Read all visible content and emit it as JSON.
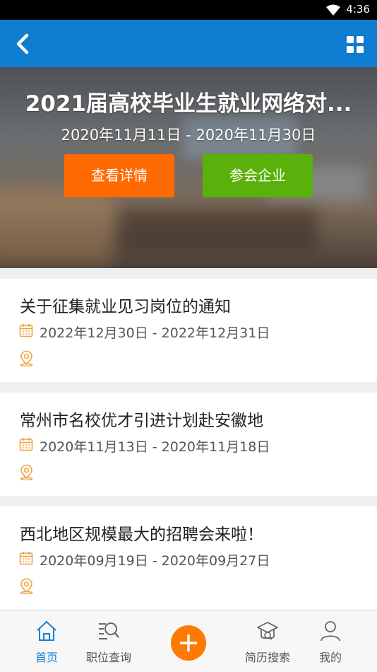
{
  "status_bar": {
    "time": "4:36"
  },
  "banner": {
    "title": "2021届高校毕业生就业网络对...",
    "date_range": "2020年11月11日 - 2020年11月30日",
    "detail_button": "查看详情",
    "company_button": "参会企业"
  },
  "jobs": [
    {
      "title": "关于征集就业见习岗位的通知",
      "date_range": "2022年12月30日 - 2022年12月31日"
    },
    {
      "title": "常州市名校优才引进计划赴安徽地",
      "date_range": "2020年11月13日 - 2020年11月18日"
    },
    {
      "title": "西北地区规模最大的招聘会来啦！",
      "date_range": "2020年09月19日 - 2020年09月27日"
    }
  ],
  "bottom_nav": {
    "home": "首页",
    "job_search": "职位查询",
    "resume_search": "简历搜索",
    "mine": "我的"
  },
  "colors": {
    "primary": "#0e7ccf",
    "detail_button": "#ff6a00",
    "company_button": "#5bb10b",
    "icon_orange": "#f0a040",
    "nav_active": "#1a7fd4",
    "fab": "#ff7a00"
  }
}
